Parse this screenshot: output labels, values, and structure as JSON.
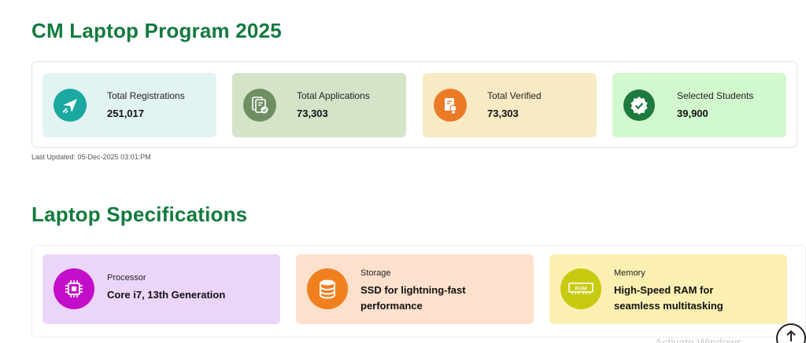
{
  "header": {
    "title": "CM Laptop Program 2025"
  },
  "stats": [
    {
      "label": "Total Registrations",
      "value": "251,017",
      "icon": "paper-plane-icon",
      "bg": "#e2f3f4",
      "circle": "#1aa8a0"
    },
    {
      "label": "Total Applications",
      "value": "73,303",
      "icon": "documents-check-icon",
      "bg": "#d5e4c8",
      "circle": "#6f8f62"
    },
    {
      "label": "Total Verified",
      "value": "73,303",
      "icon": "certificate-icon",
      "bg": "#f8ebc3",
      "circle": "#ea7a26"
    },
    {
      "label": "Selected Students",
      "value": "39,900",
      "icon": "verified-badge-icon",
      "bg": "#d2f8cd",
      "circle": "#1d7a3c"
    }
  ],
  "last_updated": "Last Updated: 05-Dec-2025 03:01:PM",
  "specs": {
    "title": "Laptop Specifications",
    "items": [
      {
        "label": "Processor",
        "value": "Core i7, 13th Generation",
        "icon": "cpu-chip-icon",
        "bg": "#ecd5fb",
        "circle": "#c20ec9"
      },
      {
        "label": "Storage",
        "value": "SSD for lightning-fast performance",
        "icon": "database-icon",
        "bg": "#fde1cc",
        "circle": "#f0801e"
      },
      {
        "label": "Memory",
        "value": "High-Speed RAM for seamless multitasking",
        "icon": "ram-stick-icon",
        "bg": "#fbf0b1",
        "circle": "#c8ca12",
        "icon_text": "RAM"
      }
    ]
  },
  "watermark": "Activate Windows"
}
